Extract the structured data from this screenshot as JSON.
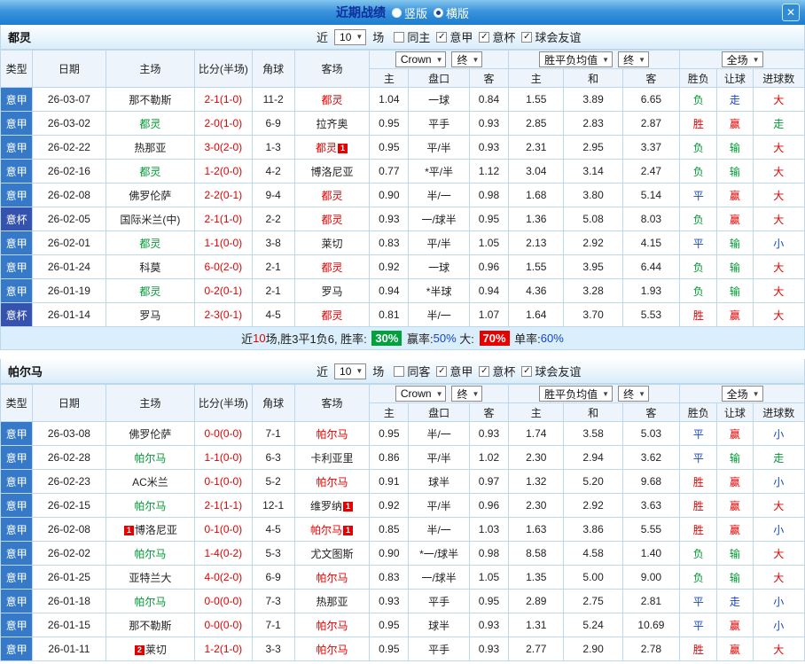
{
  "titlebar": {
    "title": "近期战绩",
    "radios": [
      {
        "label": "竖版",
        "selected": false
      },
      {
        "label": "横版",
        "selected": true
      }
    ],
    "close_label": "✕"
  },
  "columns": {
    "main": [
      "类型",
      "日期",
      "主场",
      "比分(半场)",
      "角球",
      "客场"
    ],
    "sub": [
      "主",
      "盘口",
      "客",
      "主",
      "和",
      "客",
      "胜负",
      "让球",
      "进球数"
    ],
    "odds_select": "Crown",
    "odds_period": "终",
    "avg_select": "胜平负均值",
    "avg_period": "终",
    "scope_select": "全场"
  },
  "colors": {
    "league_bg": "#3579c8",
    "cup_bg": "#3553ae",
    "win_red": "#e60000",
    "draw_blue": "#1444cc",
    "lose_green": "#009933",
    "rate_green_bg": "#00a23c",
    "rate_red_bg": "#e60000"
  },
  "sections": [
    {
      "team": "都灵",
      "filter": {
        "prefix": "近",
        "count": "10",
        "suffix": "场",
        "checkboxes": [
          {
            "label": "同主",
            "checked": false
          },
          {
            "label": "意甲",
            "checked": true
          },
          {
            "label": "意杯",
            "checked": true
          },
          {
            "label": "球会友谊",
            "checked": true
          }
        ]
      },
      "rows": [
        {
          "type": "意甲",
          "tcls": "jia",
          "date": "26-03-07",
          "home": {
            "t": "那不勒斯",
            "c": "blk"
          },
          "score": "2-1(1-0)",
          "corner": "11-2",
          "away": {
            "t": "都灵",
            "c": "red"
          },
          "o1": "1.04",
          "hc": "一球",
          "o2": "0.84",
          "w": "1.55",
          "d": "3.89",
          "l": "6.65",
          "res": {
            "t": "负",
            "c": "grn"
          },
          "rng": {
            "t": "走",
            "c": "blu"
          },
          "goal": {
            "t": "大",
            "c": "red"
          }
        },
        {
          "type": "意甲",
          "tcls": "jia",
          "date": "26-03-02",
          "home": {
            "t": "都灵",
            "c": "grn"
          },
          "score": "2-0(1-0)",
          "corner": "6-9",
          "away": {
            "t": "拉齐奥",
            "c": "blk"
          },
          "o1": "0.95",
          "hc": "平手",
          "o2": "0.93",
          "w": "2.85",
          "d": "2.83",
          "l": "2.87",
          "res": {
            "t": "胜",
            "c": "red"
          },
          "rng": {
            "t": "赢",
            "c": "red"
          },
          "goal": {
            "t": "走",
            "c": "grn"
          }
        },
        {
          "type": "意甲",
          "tcls": "jia",
          "date": "26-02-22",
          "home": {
            "t": "热那亚",
            "c": "blk"
          },
          "score": "3-0(2-0)",
          "corner": "1-3",
          "away": {
            "t": "都灵",
            "c": "red",
            "b2": "1"
          },
          "o1": "0.95",
          "hc": "平/半",
          "o2": "0.93",
          "w": "2.31",
          "d": "2.95",
          "l": "3.37",
          "res": {
            "t": "负",
            "c": "grn"
          },
          "rng": {
            "t": "输",
            "c": "grn"
          },
          "goal": {
            "t": "大",
            "c": "red"
          }
        },
        {
          "type": "意甲",
          "tcls": "jia",
          "date": "26-02-16",
          "home": {
            "t": "都灵",
            "c": "grn"
          },
          "score": "1-2(0-0)",
          "corner": "4-2",
          "away": {
            "t": "博洛尼亚",
            "c": "blk"
          },
          "o1": "0.77",
          "hc": "*平/半",
          "o2": "1.12",
          "w": "3.04",
          "d": "3.14",
          "l": "2.47",
          "res": {
            "t": "负",
            "c": "grn"
          },
          "rng": {
            "t": "输",
            "c": "grn"
          },
          "goal": {
            "t": "大",
            "c": "red"
          }
        },
        {
          "type": "意甲",
          "tcls": "jia",
          "date": "26-02-08",
          "home": {
            "t": "佛罗伦萨",
            "c": "blk"
          },
          "score": "2-2(0-1)",
          "corner": "9-4",
          "away": {
            "t": "都灵",
            "c": "red"
          },
          "o1": "0.90",
          "hc": "半/一",
          "o2": "0.98",
          "w": "1.68",
          "d": "3.80",
          "l": "5.14",
          "res": {
            "t": "平",
            "c": "blu"
          },
          "rng": {
            "t": "赢",
            "c": "red"
          },
          "goal": {
            "t": "大",
            "c": "red"
          }
        },
        {
          "type": "意杯",
          "tcls": "bei",
          "date": "26-02-05",
          "home": {
            "t": "国际米兰(中)",
            "c": "blk"
          },
          "score": "2-1(1-0)",
          "corner": "2-2",
          "away": {
            "t": "都灵",
            "c": "red"
          },
          "o1": "0.93",
          "hc": "一/球半",
          "o2": "0.95",
          "w": "1.36",
          "d": "5.08",
          "l": "8.03",
          "res": {
            "t": "负",
            "c": "grn"
          },
          "rng": {
            "t": "赢",
            "c": "red"
          },
          "goal": {
            "t": "大",
            "c": "red"
          }
        },
        {
          "type": "意甲",
          "tcls": "jia",
          "date": "26-02-01",
          "home": {
            "t": "都灵",
            "c": "grn"
          },
          "score": "1-1(0-0)",
          "corner": "3-8",
          "away": {
            "t": "莱切",
            "c": "blk"
          },
          "o1": "0.83",
          "hc": "平/半",
          "o2": "1.05",
          "w": "2.13",
          "d": "2.92",
          "l": "4.15",
          "res": {
            "t": "平",
            "c": "blu"
          },
          "rng": {
            "t": "输",
            "c": "grn"
          },
          "goal": {
            "t": "小",
            "c": "blu"
          }
        },
        {
          "type": "意甲",
          "tcls": "jia",
          "date": "26-01-24",
          "home": {
            "t": "科莫",
            "c": "blk"
          },
          "score": "6-0(2-0)",
          "corner": "2-1",
          "away": {
            "t": "都灵",
            "c": "red"
          },
          "o1": "0.92",
          "hc": "一球",
          "o2": "0.96",
          "w": "1.55",
          "d": "3.95",
          "l": "6.44",
          "res": {
            "t": "负",
            "c": "grn"
          },
          "rng": {
            "t": "输",
            "c": "grn"
          },
          "goal": {
            "t": "大",
            "c": "red"
          }
        },
        {
          "type": "意甲",
          "tcls": "jia",
          "date": "26-01-19",
          "home": {
            "t": "都灵",
            "c": "grn"
          },
          "score": "0-2(0-1)",
          "corner": "2-1",
          "away": {
            "t": "罗马",
            "c": "blk"
          },
          "o1": "0.94",
          "hc": "*半球",
          "o2": "0.94",
          "w": "4.36",
          "d": "3.28",
          "l": "1.93",
          "res": {
            "t": "负",
            "c": "grn"
          },
          "rng": {
            "t": "输",
            "c": "grn"
          },
          "goal": {
            "t": "大",
            "c": "red"
          }
        },
        {
          "type": "意杯",
          "tcls": "bei",
          "date": "26-01-14",
          "home": {
            "t": "罗马",
            "c": "blk"
          },
          "score": "2-3(0-1)",
          "corner": "4-5",
          "away": {
            "t": "都灵",
            "c": "red"
          },
          "o1": "0.81",
          "hc": "半/一",
          "o2": "1.07",
          "w": "1.64",
          "d": "3.70",
          "l": "5.53",
          "res": {
            "t": "胜",
            "c": "red"
          },
          "rng": {
            "t": "赢",
            "c": "red"
          },
          "goal": {
            "t": "大",
            "c": "red"
          }
        }
      ],
      "summary": [
        {
          "t": "近",
          "s": "plain"
        },
        {
          "t": "10",
          "s": "red"
        },
        {
          "t": "场,胜3平1负6, 胜率: ",
          "s": "plain"
        },
        {
          "t": "30%",
          "s": "greenbg"
        },
        {
          "t": " 赢率:",
          "s": "plain"
        },
        {
          "t": "50%",
          "s": "blue"
        },
        {
          "t": " 大: ",
          "s": "plain"
        },
        {
          "t": "70%",
          "s": "redbg"
        },
        {
          "t": " 单率:",
          "s": "plain"
        },
        {
          "t": "60%",
          "s": "blue"
        }
      ]
    },
    {
      "team": "帕尔马",
      "filter": {
        "prefix": "近",
        "count": "10",
        "suffix": "场",
        "checkboxes": [
          {
            "label": "同客",
            "checked": false
          },
          {
            "label": "意甲",
            "checked": true
          },
          {
            "label": "意杯",
            "checked": true
          },
          {
            "label": "球会友谊",
            "checked": true
          }
        ]
      },
      "rows": [
        {
          "type": "意甲",
          "tcls": "jia",
          "date": "26-03-08",
          "home": {
            "t": "佛罗伦萨",
            "c": "blk"
          },
          "score": "0-0(0-0)",
          "corner": "7-1",
          "away": {
            "t": "帕尔马",
            "c": "red"
          },
          "o1": "0.95",
          "hc": "半/一",
          "o2": "0.93",
          "w": "1.74",
          "d": "3.58",
          "l": "5.03",
          "res": {
            "t": "平",
            "c": "blu"
          },
          "rng": {
            "t": "赢",
            "c": "red"
          },
          "goal": {
            "t": "小",
            "c": "blu"
          }
        },
        {
          "type": "意甲",
          "tcls": "jia",
          "date": "26-02-28",
          "home": {
            "t": "帕尔马",
            "c": "grn"
          },
          "score": "1-1(0-0)",
          "corner": "6-3",
          "away": {
            "t": "卡利亚里",
            "c": "blk"
          },
          "o1": "0.86",
          "hc": "平/半",
          "o2": "1.02",
          "w": "2.30",
          "d": "2.94",
          "l": "3.62",
          "res": {
            "t": "平",
            "c": "blu"
          },
          "rng": {
            "t": "输",
            "c": "grn"
          },
          "goal": {
            "t": "走",
            "c": "grn"
          }
        },
        {
          "type": "意甲",
          "tcls": "jia",
          "date": "26-02-23",
          "home": {
            "t": "AC米兰",
            "c": "blk"
          },
          "score": "0-1(0-0)",
          "corner": "5-2",
          "away": {
            "t": "帕尔马",
            "c": "red"
          },
          "o1": "0.91",
          "hc": "球半",
          "o2": "0.97",
          "w": "1.32",
          "d": "5.20",
          "l": "9.68",
          "res": {
            "t": "胜",
            "c": "red"
          },
          "rng": {
            "t": "赢",
            "c": "red"
          },
          "goal": {
            "t": "小",
            "c": "blu"
          }
        },
        {
          "type": "意甲",
          "tcls": "jia",
          "date": "26-02-15",
          "home": {
            "t": "帕尔马",
            "c": "grn"
          },
          "score": "2-1(1-1)",
          "corner": "12-1",
          "away": {
            "t": "维罗纳",
            "c": "blk",
            "b2": "1"
          },
          "o1": "0.92",
          "hc": "平/半",
          "o2": "0.96",
          "w": "2.30",
          "d": "2.92",
          "l": "3.63",
          "res": {
            "t": "胜",
            "c": "red"
          },
          "rng": {
            "t": "赢",
            "c": "red"
          },
          "goal": {
            "t": "大",
            "c": "red"
          }
        },
        {
          "type": "意甲",
          "tcls": "jia",
          "date": "26-02-08",
          "home": {
            "t": "博洛尼亚",
            "c": "blk",
            "b1": "1"
          },
          "score": "0-1(0-0)",
          "corner": "4-5",
          "away": {
            "t": "帕尔马",
            "c": "red",
            "b2": "1"
          },
          "o1": "0.85",
          "hc": "半/一",
          "o2": "1.03",
          "w": "1.63",
          "d": "3.86",
          "l": "5.55",
          "res": {
            "t": "胜",
            "c": "red"
          },
          "rng": {
            "t": "赢",
            "c": "red"
          },
          "goal": {
            "t": "小",
            "c": "blu"
          }
        },
        {
          "type": "意甲",
          "tcls": "jia",
          "date": "26-02-02",
          "home": {
            "t": "帕尔马",
            "c": "grn"
          },
          "score": "1-4(0-2)",
          "corner": "5-3",
          "away": {
            "t": "尤文图斯",
            "c": "blk"
          },
          "o1": "0.90",
          "hc": "*一/球半",
          "o2": "0.98",
          "w": "8.58",
          "d": "4.58",
          "l": "1.40",
          "res": {
            "t": "负",
            "c": "grn"
          },
          "rng": {
            "t": "输",
            "c": "grn"
          },
          "goal": {
            "t": "大",
            "c": "red"
          }
        },
        {
          "type": "意甲",
          "tcls": "jia",
          "date": "26-01-25",
          "home": {
            "t": "亚特兰大",
            "c": "blk"
          },
          "score": "4-0(2-0)",
          "corner": "6-9",
          "away": {
            "t": "帕尔马",
            "c": "red"
          },
          "o1": "0.83",
          "hc": "一/球半",
          "o2": "1.05",
          "w": "1.35",
          "d": "5.00",
          "l": "9.00",
          "res": {
            "t": "负",
            "c": "grn"
          },
          "rng": {
            "t": "输",
            "c": "grn"
          },
          "goal": {
            "t": "大",
            "c": "red"
          }
        },
        {
          "type": "意甲",
          "tcls": "jia",
          "date": "26-01-18",
          "home": {
            "t": "帕尔马",
            "c": "grn"
          },
          "score": "0-0(0-0)",
          "corner": "7-3",
          "away": {
            "t": "热那亚",
            "c": "blk"
          },
          "o1": "0.93",
          "hc": "平手",
          "o2": "0.95",
          "w": "2.89",
          "d": "2.75",
          "l": "2.81",
          "res": {
            "t": "平",
            "c": "blu"
          },
          "rng": {
            "t": "走",
            "c": "blu"
          },
          "goal": {
            "t": "小",
            "c": "blu"
          }
        },
        {
          "type": "意甲",
          "tcls": "jia",
          "date": "26-01-15",
          "home": {
            "t": "那不勒斯",
            "c": "blk"
          },
          "score": "0-0(0-0)",
          "corner": "7-1",
          "away": {
            "t": "帕尔马",
            "c": "red"
          },
          "o1": "0.95",
          "hc": "球半",
          "o2": "0.93",
          "w": "1.31",
          "d": "5.24",
          "l": "10.69",
          "res": {
            "t": "平",
            "c": "blu"
          },
          "rng": {
            "t": "赢",
            "c": "red"
          },
          "goal": {
            "t": "小",
            "c": "blu"
          }
        },
        {
          "type": "意甲",
          "tcls": "jia",
          "date": "26-01-11",
          "home": {
            "t": "莱切",
            "c": "blk",
            "b1": "2"
          },
          "score": "1-2(1-0)",
          "corner": "3-3",
          "away": {
            "t": "帕尔马",
            "c": "red"
          },
          "o1": "0.95",
          "hc": "平手",
          "o2": "0.93",
          "w": "2.77",
          "d": "2.90",
          "l": "2.78",
          "res": {
            "t": "胜",
            "c": "red"
          },
          "rng": {
            "t": "赢",
            "c": "red"
          },
          "goal": {
            "t": "大",
            "c": "red"
          }
        }
      ]
    }
  ]
}
